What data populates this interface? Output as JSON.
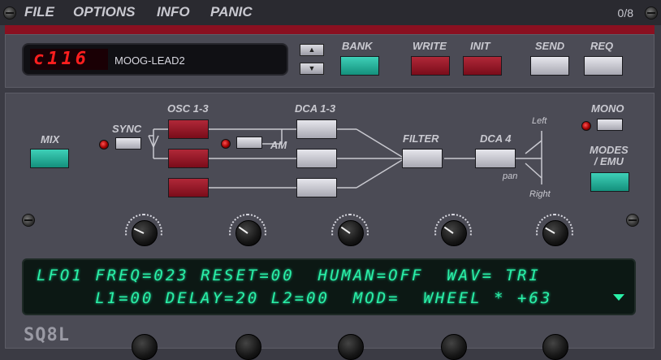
{
  "menu": {
    "items": [
      "FILE",
      "OPTIONS",
      "INFO",
      "PANIC"
    ],
    "counter": "0/8"
  },
  "display": {
    "patch_number": "c116",
    "patch_name": "MOOG-LEAD2"
  },
  "buttons": {
    "bank": "BANK",
    "write": "WRITE",
    "init": "INIT",
    "send": "SEND",
    "req": "REQ"
  },
  "sections": {
    "mix": "MIX",
    "sync": "SYNC",
    "osc": "OSC 1-3",
    "am": "AM",
    "dca": "DCA 1-3",
    "filter": "FILTER",
    "dca4": "DCA 4",
    "pan": "pan",
    "left": "Left",
    "right": "Right",
    "mono": "MONO",
    "modes": "MODES\n/ EMU"
  },
  "knobs_row1": [
    205,
    215,
    215,
    215,
    210
  ],
  "vfd": {
    "line1": "LFO1 FREQ=023 RESET=00  HUMAN=OFF  WAV= TRI",
    "line2": "     L1=00 DELAY=20 L2=00  MOD=  WHEEL * +63"
  },
  "logo": "SQ8L",
  "colors": {
    "accent_red": "#8a1020",
    "teal": "#1fb39c",
    "vfd_green": "#2af0a8"
  }
}
